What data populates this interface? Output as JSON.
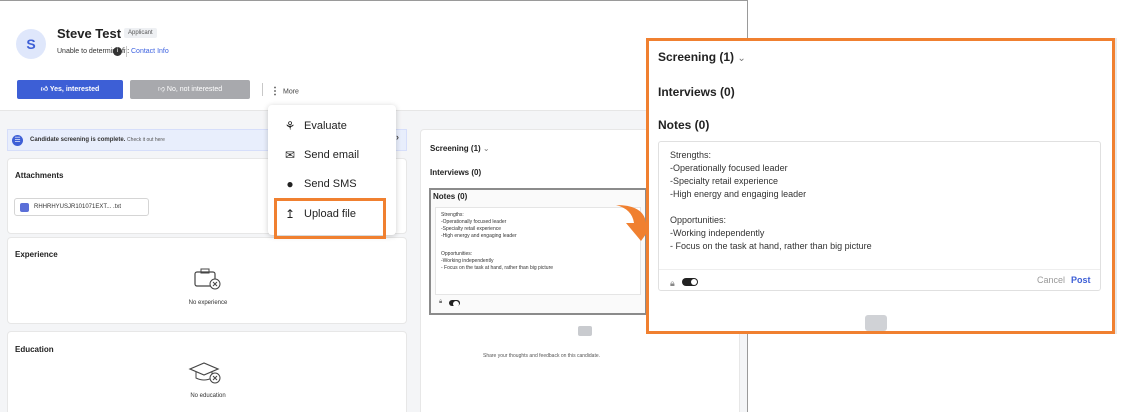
{
  "candidate": {
    "initial": "S",
    "name": "Steve Test",
    "badge": "Applicant",
    "fit_text": "Unable to determine fit:",
    "contact_link": "Contact Info"
  },
  "actions": {
    "yes_label": "Yes, interested",
    "no_label": "No, not interested",
    "more_label": "More"
  },
  "banner": {
    "text": "Candidate screening is complete.",
    "link": "Check it out here"
  },
  "sections": {
    "attachments_title": "Attachments",
    "attachment_file": "RHHRHYUSJR101071EXT... .txt",
    "experience_title": "Experience",
    "experience_empty": "No experience",
    "education_title": "Education",
    "education_empty": "No education"
  },
  "right_panel": {
    "screening": "Screening (1)",
    "interviews": "Interviews (0)",
    "notes": "Notes (0)",
    "share_text": "Share your thoughts and feedback on this candidate."
  },
  "note_lines": [
    "Strengths:",
    "-Operationally focused leader",
    "-Specialty retail experience",
    "-High energy and engaging leader",
    "",
    "Opportunities:",
    "-Working independently",
    "- Focus on the task at hand, rather than big picture"
  ],
  "menu": [
    {
      "icon": "evaluate-icon",
      "label": "Evaluate"
    },
    {
      "icon": "email-icon",
      "label": "Send email"
    },
    {
      "icon": "sms-icon",
      "label": "Send SMS"
    },
    {
      "icon": "upload-icon",
      "label": "Upload file"
    }
  ],
  "zoom": {
    "screening": "Screening (1)",
    "interviews": "Interviews (0)",
    "notes": "Notes (0)",
    "cancel": "Cancel",
    "post": "Post"
  },
  "colors": {
    "primary": "#3d5fd6",
    "highlight": "#f08030",
    "disabled": "#a8a9ad"
  }
}
